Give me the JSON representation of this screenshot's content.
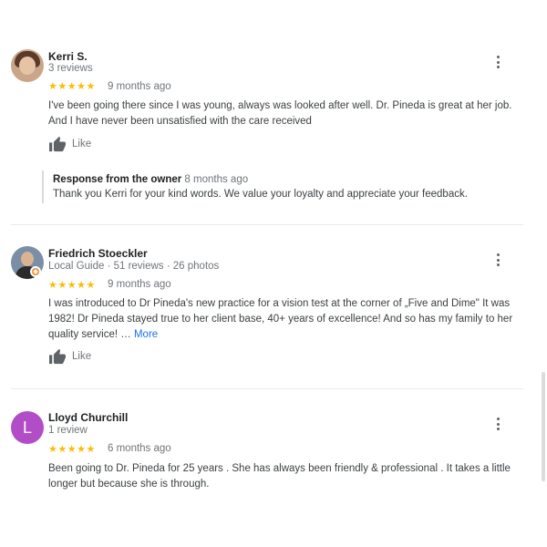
{
  "reviews": [
    {
      "name": "Kerri S.",
      "meta": "3 reviews",
      "stars": "★★★★★",
      "date": "9 months ago",
      "text": "I've been going there since I was young, always was looked after well. Dr. Pineda is great at her job. And I have never been unsatisfied with the care received",
      "like": "Like",
      "response": {
        "title": "Response from the owner",
        "date": "8 months ago",
        "text": "Thank you Kerri for your kind words. We value your loyalty and appreciate your feedback."
      }
    },
    {
      "name": "Friedrich Stoeckler",
      "meta": "Local Guide · 51 reviews · 26 photos",
      "stars": "★★★★★",
      "date": "9 months ago",
      "text": "I was introduced to Dr Pineda's new practice for a vision test at the corner of „Five and Dime\" It was 1982! Dr Pineda stayed true to her client base, 40+ years of excellence! And so has my family to her quality service! …",
      "more": "More",
      "like": "Like"
    },
    {
      "name": "Lloyd Churchill",
      "avatar_letter": "L",
      "meta": "1 review",
      "stars": "★★★★★",
      "date": "6 months ago",
      "text": "Been going to Dr. Pineda for 25 years . She has always been  friendly & professional . It takes a little longer but because she is through."
    }
  ],
  "colors": {
    "star": "#fbbc04",
    "link": "#1a73e8",
    "avatar_letter_bg": "#b14dc6",
    "guide_badge": "#f28b30"
  }
}
